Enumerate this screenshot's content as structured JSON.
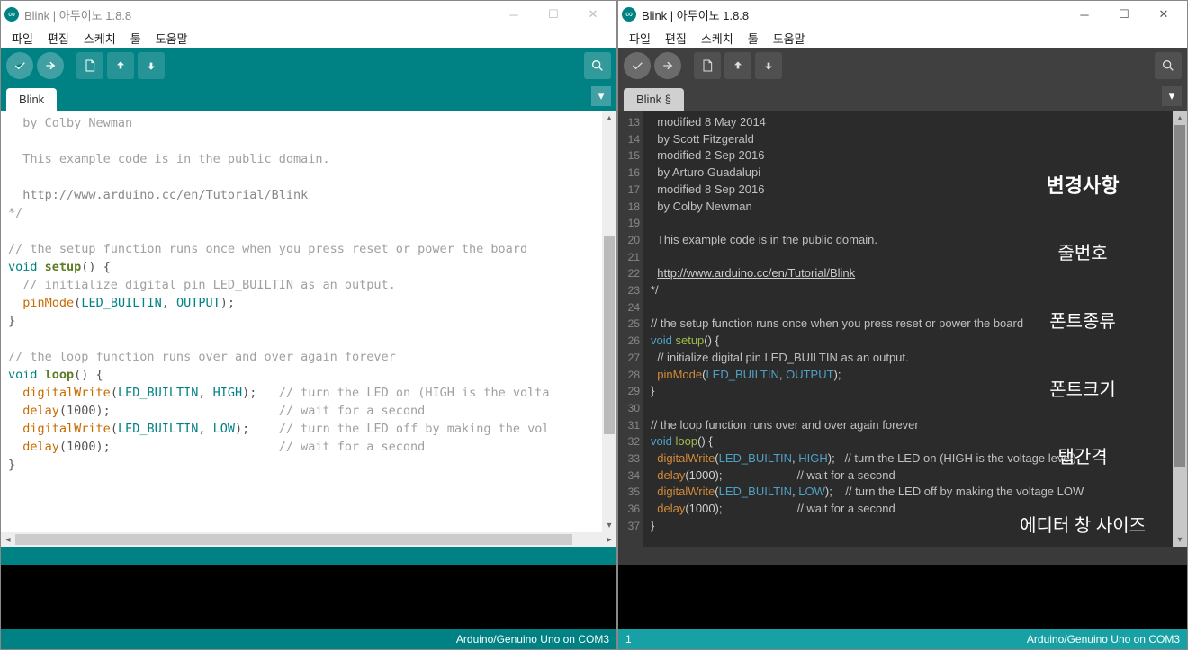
{
  "left": {
    "title": "Blink | 아두이노 1.8.8",
    "menu": [
      "파일",
      "편집",
      "스케치",
      "툴",
      "도움말"
    ],
    "tab": "Blink",
    "footer": "Arduino/Genuino Uno on COM3",
    "code": {
      "l1": "  by Colby Newman",
      "l2": "",
      "l3": "  This example code is in the public domain.",
      "l4": "",
      "l5a": "  ",
      "l5b": "http://www.arduino.cc/en/Tutorial/Blink",
      "l6": "*/",
      "l7": "",
      "l8": "// the setup function runs once when you press reset or power the board",
      "l9a": "void",
      "l9b": " ",
      "l9c": "setup",
      "l9d": "() {",
      "l10": "  // initialize digital pin LED_BUILTIN as an output.",
      "l11a": "  ",
      "l11b": "pinMode",
      "l11c": "(",
      "l11d": "LED_BUILTIN",
      "l11e": ", ",
      "l11f": "OUTPUT",
      "l11g": ");",
      "l12": "}",
      "l13": "",
      "l14": "// the loop function runs over and over again forever",
      "l15a": "void",
      "l15b": " ",
      "l15c": "loop",
      "l15d": "() {",
      "l16a": "  ",
      "l16b": "digitalWrite",
      "l16c": "(",
      "l16d": "LED_BUILTIN",
      "l16e": ", ",
      "l16f": "HIGH",
      "l16g": ");   ",
      "l16h": "// turn the LED on (HIGH is the volta",
      "l17a": "  ",
      "l17b": "delay",
      "l17c": "(1000);                       ",
      "l17d": "// wait for a second",
      "l18a": "  ",
      "l18b": "digitalWrite",
      "l18c": "(",
      "l18d": "LED_BUILTIN",
      "l18e": ", ",
      "l18f": "LOW",
      "l18g": ");    ",
      "l18h": "// turn the LED off by making the vol",
      "l19a": "  ",
      "l19b": "delay",
      "l19c": "(1000);                       ",
      "l19d": "// wait for a second",
      "l20": "}"
    }
  },
  "right": {
    "title": "Blink | 아두이노 1.8.8",
    "menu": [
      "파일",
      "편집",
      "스케치",
      "툴",
      "도움말"
    ],
    "tab": "Blink §",
    "footer_left": "1",
    "footer_right": "Arduino/Genuino Uno on COM3",
    "line_start": 13,
    "line_end": 37,
    "overlay": {
      "title": "변경사항",
      "items": [
        "줄번호",
        "폰트종류",
        "폰트크기",
        "탭간격",
        "에디터 창 사이즈"
      ]
    },
    "code": {
      "l13": "  modified 8 May 2014",
      "l14": "  by Scott Fitzgerald",
      "l15": "  modified 2 Sep 2016",
      "l16": "  by Arturo Guadalupi",
      "l17": "  modified 8 Sep 2016",
      "l18": "  by Colby Newman",
      "l19": "",
      "l20": "  This example code is in the public domain.",
      "l21": "",
      "l22a": "  ",
      "l22b": "http://www.arduino.cc/en/Tutorial/Blink",
      "l23": "*/",
      "l24": "",
      "l25": "// the setup function runs once when you press reset or power the board",
      "l26a": "void",
      "l26b": " ",
      "l26c": "setup",
      "l26d": "() {",
      "l27": "  // initialize digital pin LED_BUILTIN as an output.",
      "l28a": "  ",
      "l28b": "pinMode",
      "l28c": "(",
      "l28d": "LED_BUILTIN",
      "l28e": ", ",
      "l28f": "OUTPUT",
      "l28g": ");",
      "l29": "}",
      "l30": "",
      "l31": "// the loop function runs over and over again forever",
      "l32a": "void",
      "l32b": " ",
      "l32c": "loop",
      "l32d": "() {",
      "l33a": "  ",
      "l33b": "digitalWrite",
      "l33c": "(",
      "l33d": "LED_BUILTIN",
      "l33e": ", ",
      "l33f": "HIGH",
      "l33g": ");   ",
      "l33h": "// turn the LED on (HIGH is the voltage level)",
      "l34a": "  ",
      "l34b": "delay",
      "l34c": "(1000);                       ",
      "l34d": "// wait for a second",
      "l35a": "  ",
      "l35b": "digitalWrite",
      "l35c": "(",
      "l35d": "LED_BUILTIN",
      "l35e": ", ",
      "l35f": "LOW",
      "l35g": ");    ",
      "l35h": "// turn the LED off by making the voltage LOW",
      "l36a": "  ",
      "l36b": "delay",
      "l36c": "(1000);                       ",
      "l36d": "// wait for a second",
      "l37": "}"
    }
  }
}
